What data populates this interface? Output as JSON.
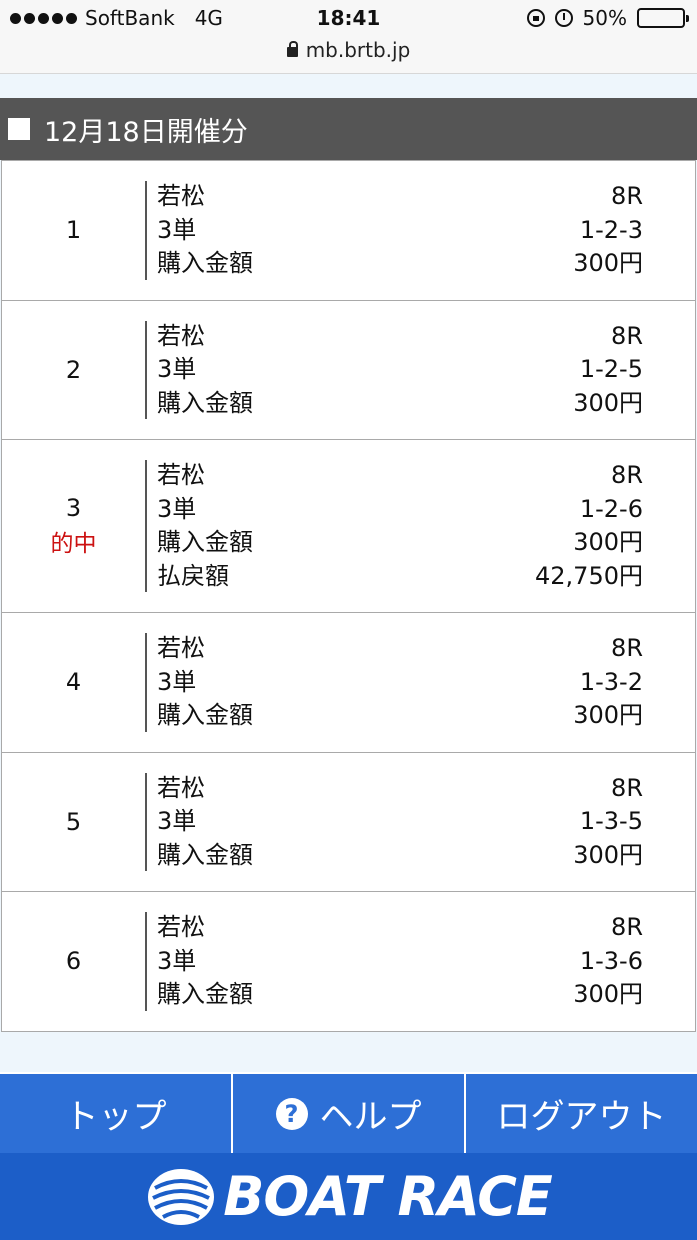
{
  "status_bar": {
    "carrier": "SoftBank",
    "network": "4G",
    "time": "18:41",
    "battery_percent": "50%",
    "battery_level": 0.5,
    "url": "mb.brtb.jp"
  },
  "header": {
    "title": "12月18日開催分"
  },
  "bets": [
    {
      "number": "1",
      "hit": "",
      "venue": "若松",
      "race": "8R",
      "bet_type": "3単",
      "combination": "1-2-3",
      "amount_label": "購入金額",
      "amount": "300円"
    },
    {
      "number": "2",
      "hit": "",
      "venue": "若松",
      "race": "8R",
      "bet_type": "3単",
      "combination": "1-2-5",
      "amount_label": "購入金額",
      "amount": "300円"
    },
    {
      "number": "3",
      "hit": "的中",
      "venue": "若松",
      "race": "8R",
      "bet_type": "3単",
      "combination": "1-2-6",
      "amount_label": "購入金額",
      "amount": "300円",
      "payout_label": "払戻額",
      "payout": "42,750円"
    },
    {
      "number": "4",
      "hit": "",
      "venue": "若松",
      "race": "8R",
      "bet_type": "3単",
      "combination": "1-3-2",
      "amount_label": "購入金額",
      "amount": "300円"
    },
    {
      "number": "5",
      "hit": "",
      "venue": "若松",
      "race": "8R",
      "bet_type": "3単",
      "combination": "1-3-5",
      "amount_label": "購入金額",
      "amount": "300円"
    },
    {
      "number": "6",
      "hit": "",
      "venue": "若松",
      "race": "8R",
      "bet_type": "3単",
      "combination": "1-3-6",
      "amount_label": "購入金額",
      "amount": "300円"
    }
  ],
  "nav": {
    "top_label": "トップ",
    "help_label": "ヘルプ",
    "help_icon_glyph": "?",
    "logout_label": "ログアウト"
  },
  "brand": {
    "text": "BOAT RACE"
  },
  "colors": {
    "header_bg": "#555555",
    "hit_text": "#cc1111",
    "nav_bg": "#2d6fd6",
    "brand_bg": "#1c5ec8"
  }
}
